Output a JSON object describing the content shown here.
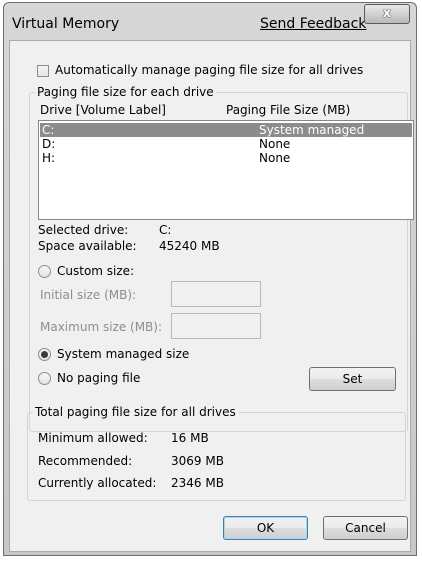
{
  "window": {
    "title": "Virtual Memory",
    "feedback_link": "Send Feedback",
    "close_glyph": "x"
  },
  "auto_manage": {
    "label": "Automatically manage paging file size for all drives",
    "checked": false
  },
  "paging_group": {
    "legend": "Paging file size for each drive",
    "col_drive": "Drive  [Volume Label]",
    "col_size": "Paging File Size (MB)",
    "rows": [
      {
        "drive": "C:",
        "size": "System managed",
        "selected": true
      },
      {
        "drive": "D:",
        "size": "None",
        "selected": false
      },
      {
        "drive": "H:",
        "size": "None",
        "selected": false
      }
    ],
    "selected_drive_label": "Selected drive:",
    "selected_drive_value": "C:",
    "space_label": "Space available:",
    "space_value": "45240 MB",
    "custom_size_label": "Custom size:",
    "initial_size_label": "Initial size (MB):",
    "maximum_size_label": "Maximum size (MB):",
    "system_managed_label": "System managed size",
    "no_paging_label": "No paging file",
    "set_button": "Set",
    "selected_option": "system_managed"
  },
  "total_group": {
    "legend": "Total paging file size for all drives",
    "min_label": "Minimum allowed:",
    "min_value": "16 MB",
    "rec_label": "Recommended:",
    "rec_value": "3069 MB",
    "cur_label": "Currently allocated:",
    "cur_value": "2346 MB"
  },
  "buttons": {
    "ok": "OK",
    "cancel": "Cancel"
  }
}
